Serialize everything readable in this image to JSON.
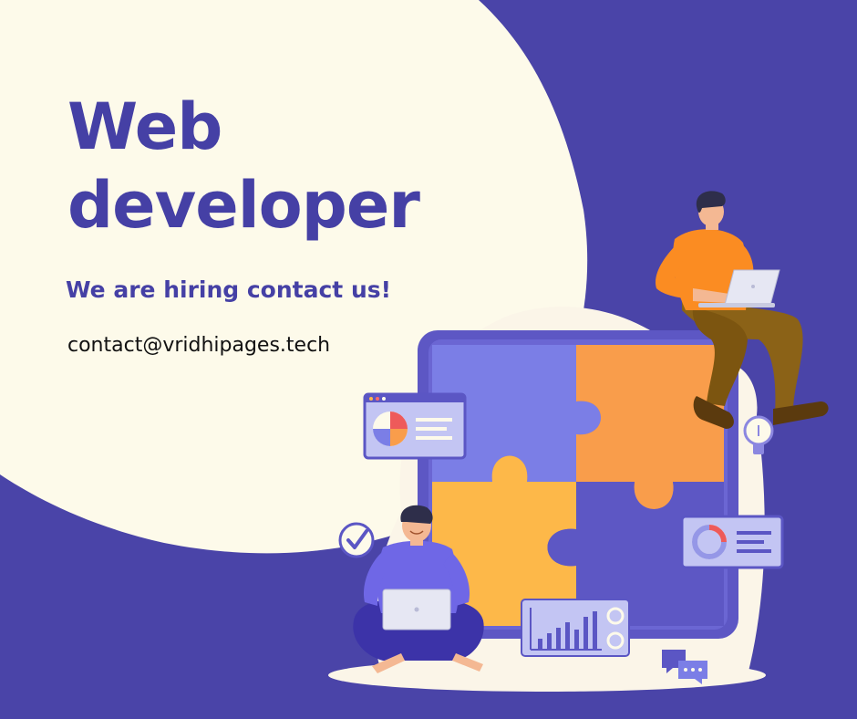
{
  "poster": {
    "headline_line1": "Web",
    "headline_line2": "developer",
    "subheading": "We are hiring contact us!",
    "email": "contact@vridhipages.tech"
  },
  "colors": {
    "background": "#4a44a8",
    "blob": "#fdfaea",
    "headline_text": "#4540a5",
    "puzzle_blue": "#7b7ee6",
    "puzzle_orange": "#f99d4b",
    "puzzle_yellow": "#fdb849",
    "puzzle_purple": "#5d57c4",
    "shirt_orange": "#fb8c22"
  },
  "illustration": {
    "elements": [
      "puzzle-board",
      "developer-sitting-on-board",
      "developer-cross-legged",
      "pie-chart-card",
      "progress-card",
      "bar-chart-card",
      "checkmark-icon",
      "lightbulb-icon",
      "chat-bubbles-icon"
    ]
  }
}
